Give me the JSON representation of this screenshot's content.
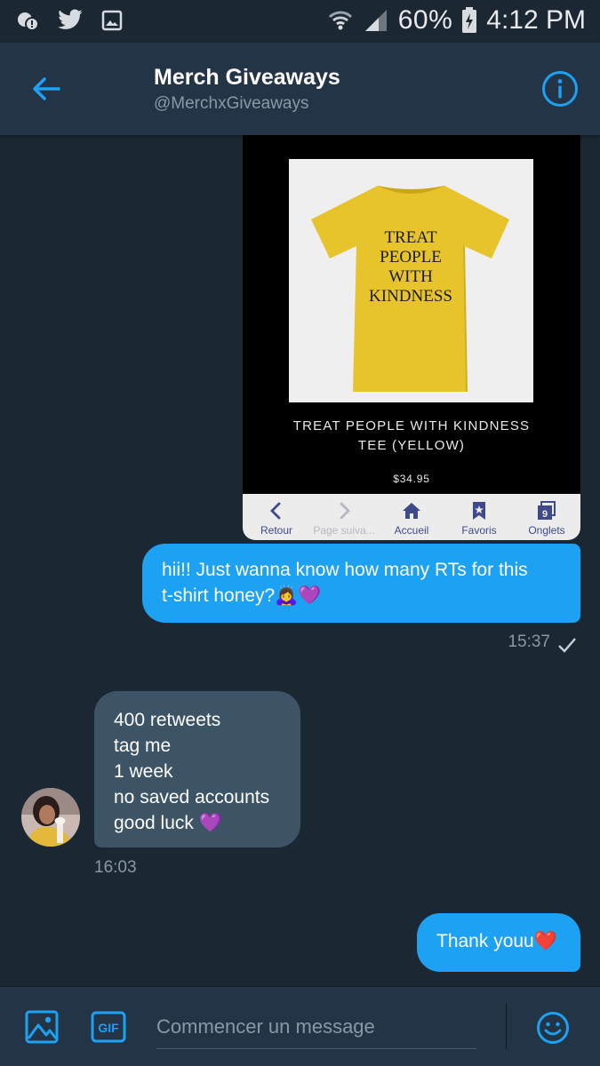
{
  "status_bar": {
    "battery_percent": "60%",
    "time": "4:12 PM",
    "icons": [
      "cast-notification-icon",
      "twitter-bird-icon",
      "image-notification-icon",
      "wifi-icon",
      "signal-icon",
      "battery-charging-icon"
    ]
  },
  "header": {
    "title": "Merch Giveaways",
    "handle": "@MerchxGiveaways",
    "icons": [
      "back-arrow-icon",
      "info-icon"
    ]
  },
  "conversation": {
    "image_message": {
      "shirt_text": [
        "TREAT",
        "PEOPLE",
        "WITH",
        "KINDNESS"
      ],
      "product_name_line1": "TREAT PEOPLE WITH KINDNESS",
      "product_name_line2": "TEE (YELLOW)",
      "price": "$34.95",
      "browser_bar": [
        {
          "label": "Retour",
          "icon": "chevron-left-icon",
          "disabled": false
        },
        {
          "label": "Page suiva...",
          "icon": "chevron-right-icon",
          "disabled": true
        },
        {
          "label": "Accueil",
          "icon": "home-icon",
          "disabled": false
        },
        {
          "label": "Favoris",
          "icon": "bookmark-icon",
          "disabled": false
        },
        {
          "label": "Onglets",
          "icon": "tabs-icon",
          "disabled": false,
          "count": "9"
        }
      ]
    },
    "sent_message_1": {
      "line1": "hii!! Just wanna know how many RTs for this",
      "line2": "t-shirt honey?🙇‍♀️💜",
      "time": "15:37"
    },
    "received_message": {
      "lines": [
        "400 retweets",
        "tag me",
        "1 week",
        "no saved accounts",
        "good luck 💜"
      ],
      "time": "16:03"
    },
    "sent_message_2": {
      "text": "Thank youu❤️"
    }
  },
  "composer": {
    "placeholder": "Commencer un message",
    "gif_label": "GIF",
    "icons": [
      "image-icon",
      "gif-icon",
      "emoji-icon"
    ]
  },
  "colors": {
    "background": "#1b2733",
    "header": "#243447",
    "accent": "#1da1f2",
    "received_bubble": "#3d5466",
    "muted_text": "#8899a6"
  }
}
